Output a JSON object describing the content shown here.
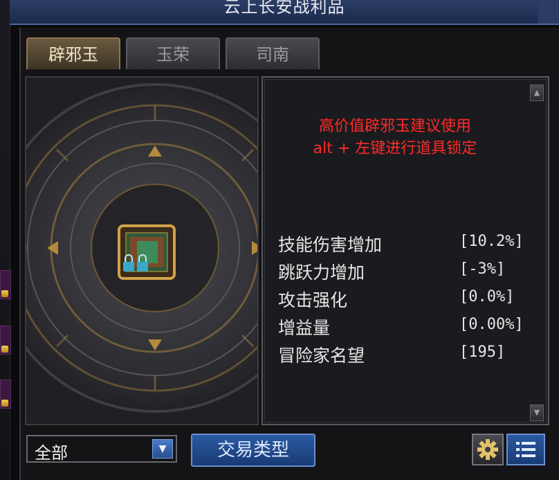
{
  "window": {
    "title": "云上长安战利品"
  },
  "tabs": [
    {
      "label": "辟邪玉",
      "active": true
    },
    {
      "label": "玉荣",
      "active": false
    },
    {
      "label": "司南",
      "active": false
    }
  ],
  "info": {
    "warning_line1": "高价值辟邪玉建议使用",
    "warning_line2": "alt + 左键进行道具锁定",
    "stats": [
      {
        "name": "技能伤害增加",
        "value": "[10.2%]"
      },
      {
        "name": "跳跃力增加",
        "value": "[-3%]"
      },
      {
        "name": "攻击强化",
        "value": "[0.0%]"
      },
      {
        "name": "增益量",
        "value": "[0.00%]"
      },
      {
        "name": "冒险家名望",
        "value": "[195]"
      }
    ]
  },
  "filter": {
    "selected": "全部"
  },
  "buttons": {
    "trade_type": "交易类型"
  },
  "icons": {
    "gear": "gear-icon",
    "list": "list-icon",
    "lock": "lock-icon",
    "dropdown": "chevron-down-icon",
    "scroll_up": "scroll-up-icon",
    "scroll_down": "scroll-down-icon"
  },
  "colors": {
    "warning": "#ff2a2a",
    "accent_blue": "#2a5aa2",
    "gold": "#c9a24a"
  }
}
